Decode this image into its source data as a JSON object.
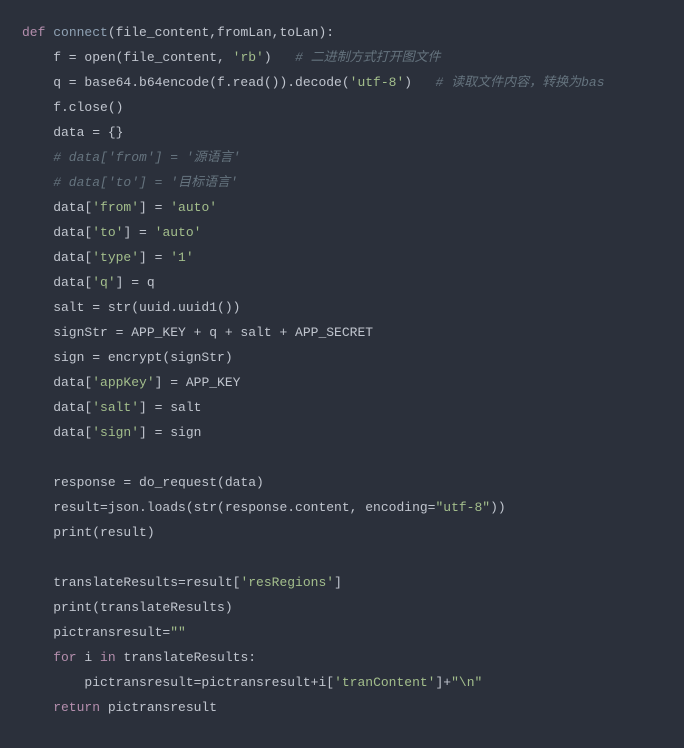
{
  "code": {
    "l1_kw": "def",
    "l1_fn": "connect",
    "l1_rest": "(file_content,fromLan,toLan):",
    "l2_a": "    f = open(file_content, ",
    "l2_str": "'rb'",
    "l2_b": ")   ",
    "l2_cmt": "# 二进制方式打开图文件",
    "l3_a": "    q = base64.b64encode(f.read()).decode(",
    "l3_str": "'utf-8'",
    "l3_b": ")   ",
    "l3_cmt": "# 读取文件内容，转换为bas",
    "l4": "    f.close()",
    "l5": "    data = {}",
    "l6_cmt": "    # data['from'] = '源语言'",
    "l7_cmt": "    # data['to'] = '目标语言'",
    "l8_a": "    data[",
    "l8_k": "'from'",
    "l8_b": "] = ",
    "l8_v": "'auto'",
    "l9_a": "    data[",
    "l9_k": "'to'",
    "l9_b": "] = ",
    "l9_v": "'auto'",
    "l10_a": "    data[",
    "l10_k": "'type'",
    "l10_b": "] = ",
    "l10_v": "'1'",
    "l11_a": "    data[",
    "l11_k": "'q'",
    "l11_b": "] = q",
    "l12": "    salt = str(uuid.uuid1())",
    "l13": "    signStr = APP_KEY + q + salt + APP_SECRET",
    "l14": "    sign = encrypt(signStr)",
    "l15_a": "    data[",
    "l15_k": "'appKey'",
    "l15_b": "] = APP_KEY",
    "l16_a": "    data[",
    "l16_k": "'salt'",
    "l16_b": "] = salt",
    "l17_a": "    data[",
    "l17_k": "'sign'",
    "l17_b": "] = sign",
    "l18": "",
    "l19": "    response = do_request(data)",
    "l20_a": "    result=json.loads(str(response.content, encoding=",
    "l20_str": "\"utf-8\"",
    "l20_b": "))",
    "l21": "    print(result)",
    "l22": "",
    "l23_a": "    translateResults=result[",
    "l23_k": "'resRegions'",
    "l23_b": "]",
    "l24": "    print(translateResults)",
    "l25_a": "    pictransresult=",
    "l25_str": "\"\"",
    "l26_for": "    for",
    "l26_a": " i ",
    "l26_in": "in",
    "l26_b": " translateResults:",
    "l27_a": "        pictransresult=pictransresult+i[",
    "l27_k": "'tranContent'",
    "l27_b": "]+",
    "l27_nl": "\"\\n\"",
    "l28_ret": "    return",
    "l28_b": " pictransresult"
  }
}
